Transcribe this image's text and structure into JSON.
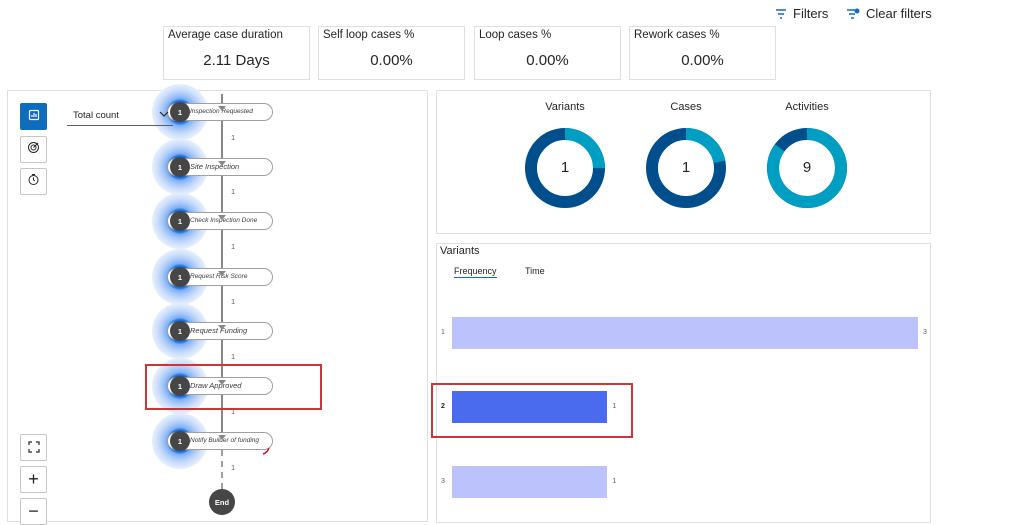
{
  "toolbar": {
    "filters_label": "Filters",
    "clear_filters_label": "Clear filters"
  },
  "kpis": [
    {
      "label": "Average case duration",
      "value": "2.11 Days"
    },
    {
      "label": "Self loop cases %",
      "value": "0.00%"
    },
    {
      "label": "Loop cases %",
      "value": "0.00%"
    },
    {
      "label": "Rework cases %",
      "value": "0.00%"
    }
  ],
  "process_map": {
    "metric_select": "Total count",
    "nodes": [
      {
        "label": "Inspection Requested",
        "count": "1"
      },
      {
        "label": "Site Inspection",
        "count": "1"
      },
      {
        "label": "Check Inspection Done",
        "count": "1"
      },
      {
        "label": "Request Risk Score",
        "count": "1"
      },
      {
        "label": "Request Funding",
        "count": "1"
      },
      {
        "label": "Draw Approved",
        "count": "1"
      },
      {
        "label": "Notify Builder of funding",
        "count": "1"
      }
    ],
    "edges": [
      "1",
      "1",
      "1",
      "1",
      "1",
      "1",
      "1"
    ],
    "end_label": "End",
    "zoom_in_label": "+",
    "zoom_out_label": "−"
  },
  "summary": {
    "donuts": [
      {
        "title": "Variants",
        "value": "1",
        "fill_fraction": 0.25
      },
      {
        "title": "Cases",
        "value": "1",
        "fill_fraction": 0.22
      },
      {
        "title": "Activities",
        "value": "9",
        "fill_fraction": 0.85
      }
    ],
    "colors": {
      "dark": "#004e8c",
      "light": "#009ec2"
    }
  },
  "variants_panel": {
    "title": "Variants",
    "tabs": [
      "Frequency",
      "Time"
    ],
    "selected_tab": "Frequency"
  },
  "chart_data": {
    "type": "bar",
    "orientation": "horizontal",
    "categories": [
      "1",
      "2",
      "3"
    ],
    "values": [
      3,
      1,
      1
    ],
    "value_labels": [
      "3",
      "1",
      "1"
    ],
    "selected_category": "2",
    "colors": {
      "default": "#bcc2fb",
      "selected": "#4b6bef"
    },
    "xlim": [
      0,
      3
    ]
  }
}
